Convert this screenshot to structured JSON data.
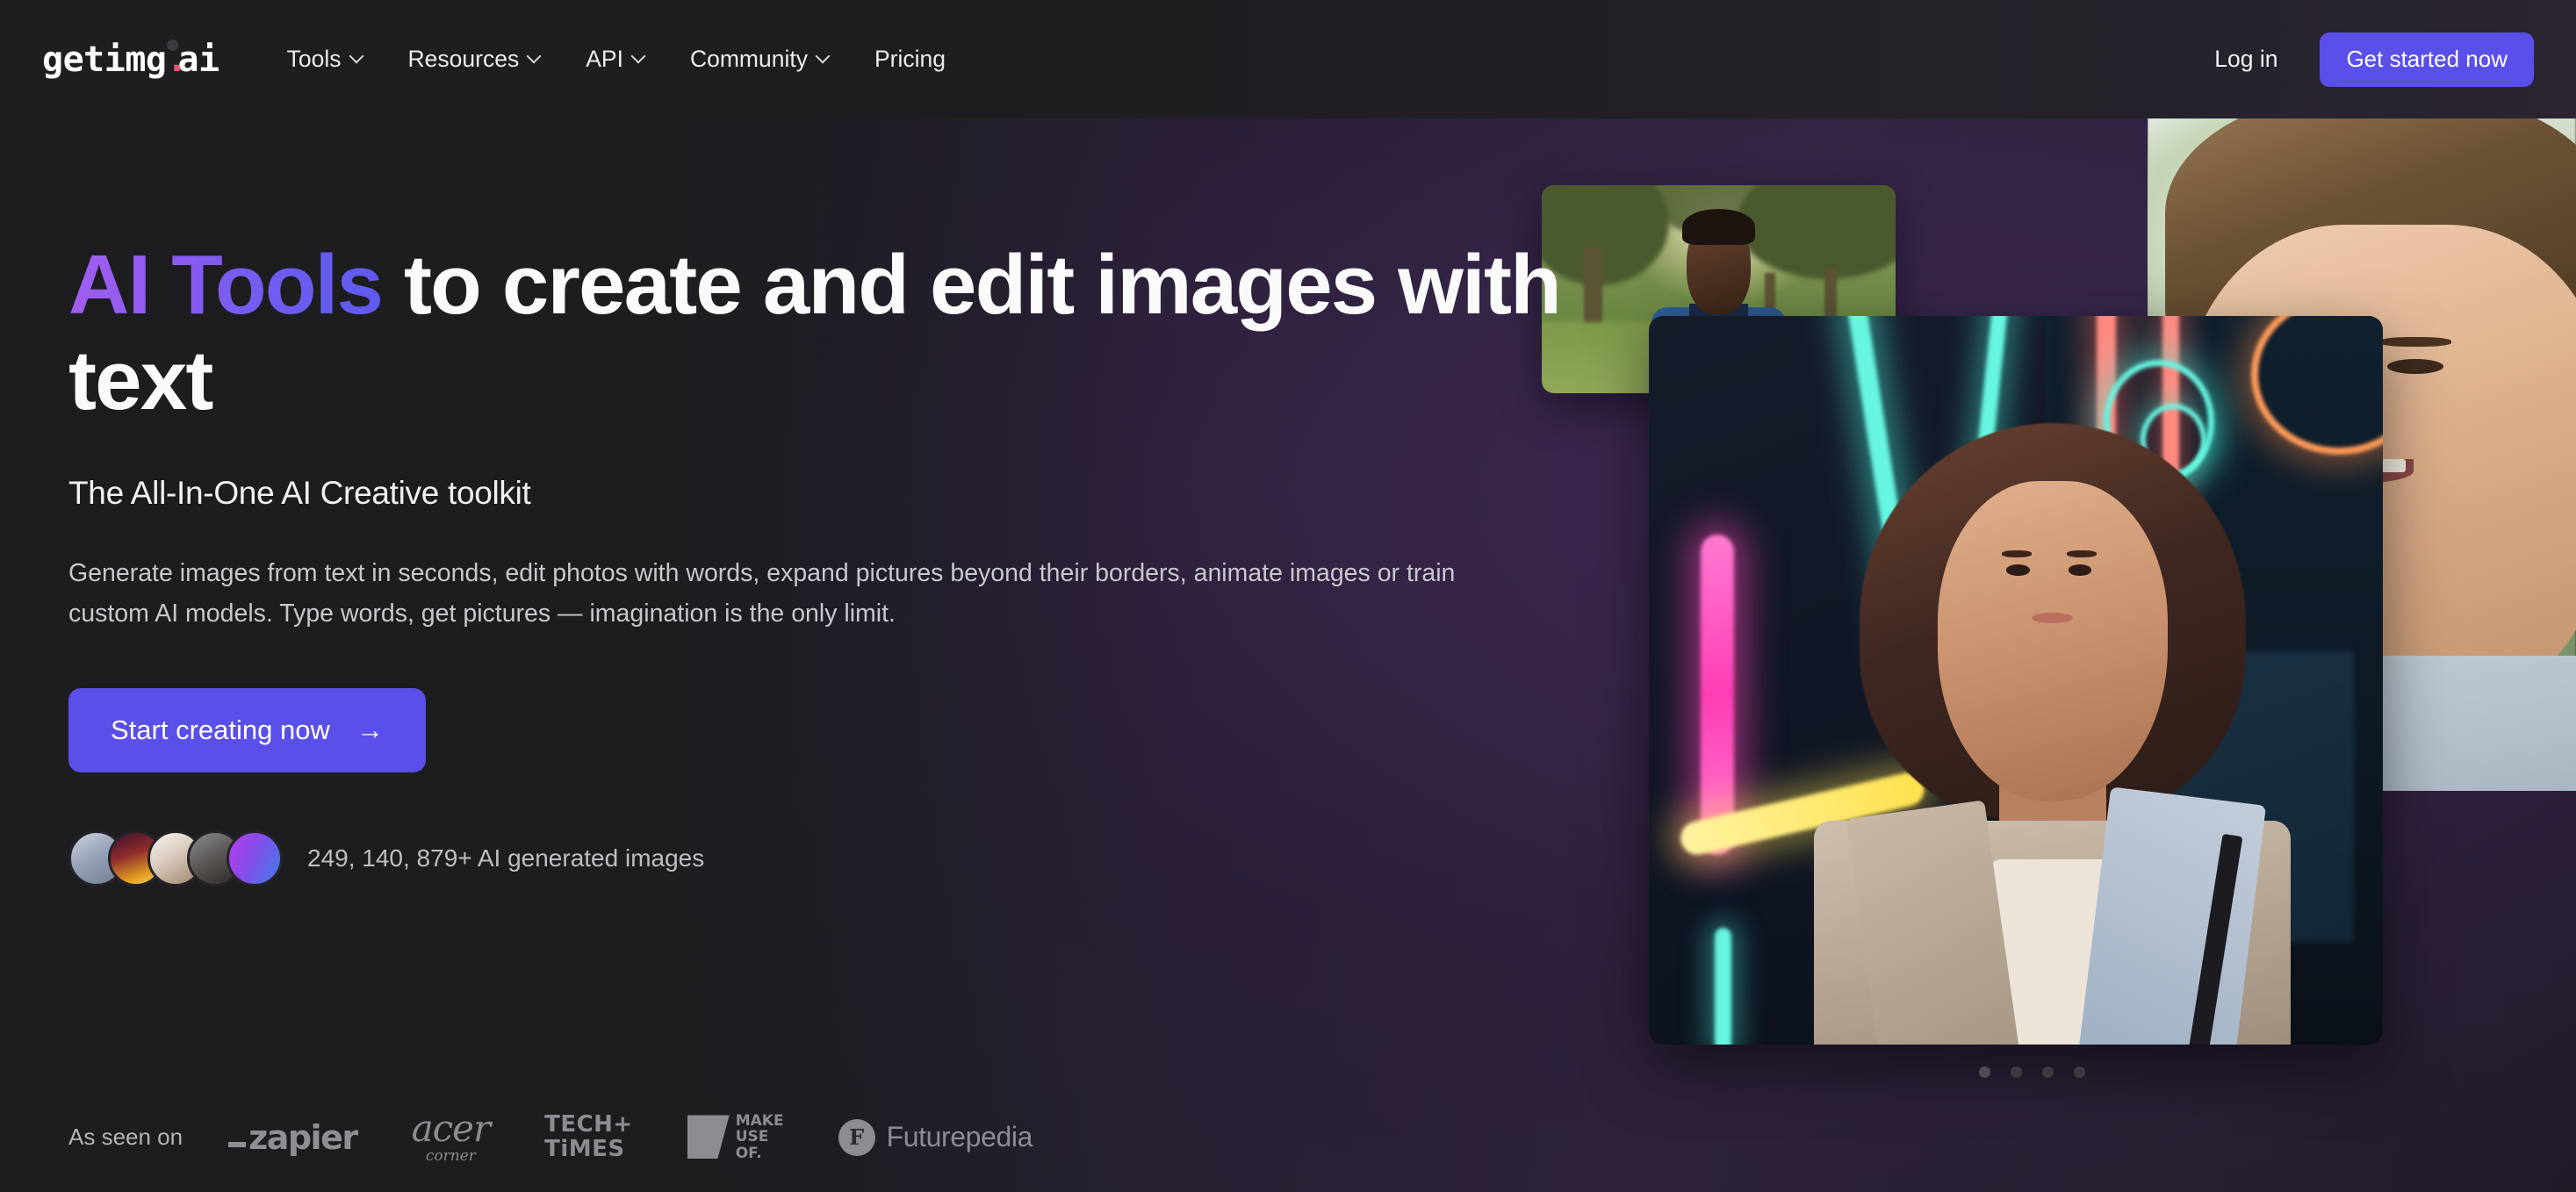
{
  "nav": {
    "logo": {
      "name": "getimg",
      "dot": ".",
      "tld": "ai"
    },
    "items": [
      {
        "label": "Tools",
        "has_dropdown": true
      },
      {
        "label": "Resources",
        "has_dropdown": true
      },
      {
        "label": "API",
        "has_dropdown": true
      },
      {
        "label": "Community",
        "has_dropdown": true
      },
      {
        "label": "Pricing",
        "has_dropdown": false
      }
    ],
    "login_label": "Log in",
    "cta_label": "Get started now"
  },
  "hero": {
    "headline_accent": "AI Tools",
    "headline_rest": " to create and edit images with text",
    "subheadline": "The All-In-One AI Creative toolkit",
    "body": "Generate images from text in seconds, edit photos with words, expand pictures beyond their borders, animate images or train custom AI models. Type words, get pictures — imagination is the only limit.",
    "cta_label": "Start creating now",
    "cta_arrow": "→",
    "social_proof_count": "249, 140, 879+ AI generated images",
    "carousel_dots": 4,
    "carousel_active_index": 0
  },
  "as_seen_on": {
    "label": "As seen on",
    "brands": [
      {
        "id": "zapier",
        "name": "zapier"
      },
      {
        "id": "acer",
        "name": "acer",
        "sub": "corner"
      },
      {
        "id": "techtimes",
        "line1": "TECH+",
        "line2": "TiMES"
      },
      {
        "id": "makeuseof",
        "line1": "MAKE",
        "line2": "USE",
        "line3": "OF."
      },
      {
        "id": "futurepedia",
        "mark": "F",
        "name": "Futurepedia"
      }
    ]
  },
  "colors": {
    "accent_purple": "#5a4fe8",
    "logo_dot_pink": "#f0536e",
    "gradient_start": "#a25ef0",
    "gradient_end": "#5f5bf0",
    "page_bg": "#1c1c1f",
    "muted_text": "#c9c7cd",
    "brand_gray": "#8c8c93"
  }
}
